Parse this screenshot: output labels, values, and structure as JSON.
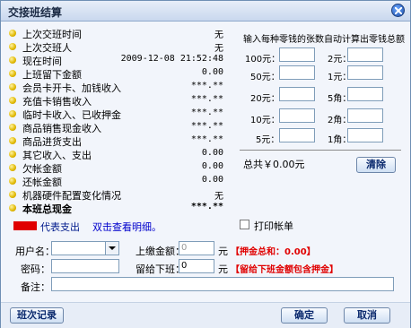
{
  "window": {
    "title": "交接班结算"
  },
  "summary": {
    "rows": [
      {
        "label": "上次交班时间",
        "value": "无"
      },
      {
        "label": "上次交班人",
        "value": "无"
      },
      {
        "label": "现在时间",
        "value": "2009-12-08 21:52:48"
      },
      {
        "label": "上班留下金额",
        "value": "0.00"
      },
      {
        "label": "会员卡开卡、加钱收入",
        "value": "***.**"
      },
      {
        "label": "充值卡销售收入",
        "value": "***.**"
      },
      {
        "label": "临时卡收入、已收押金",
        "value": "***.**"
      },
      {
        "label": "商品销售现金收入",
        "value": "***.**"
      },
      {
        "label": "商品进货支出",
        "value": "***.**"
      },
      {
        "label": "其它收入、支出",
        "value": "0.00"
      },
      {
        "label": "欠帐金额",
        "value": "0.00"
      },
      {
        "label": "还帐金额",
        "value": "0.00"
      },
      {
        "label": "机器硬件配置变化情况",
        "value": "无"
      },
      {
        "label": "本班总现金",
        "value": "***.**"
      }
    ]
  },
  "legend": {
    "text": "代表支出",
    "link": "双击查看明细。",
    "color": "#e00000"
  },
  "money": {
    "hint": "输入每种零钱的张数自动计算出零钱总额",
    "left": [
      "100元：",
      "50元：",
      "20元：",
      "10元：",
      "5元："
    ],
    "right": [
      "2元：",
      "1元：",
      "5角：",
      "2角：",
      "1角："
    ],
    "total": "总共￥0.00元",
    "clear": "清除"
  },
  "print": {
    "label": "打印帐单"
  },
  "form": {
    "user_label": "用户名：",
    "password_label": "密码：",
    "paid_label": "上缴金额：",
    "paid_value": "0",
    "unit1": "元",
    "note1": "【押金总和：0.00】",
    "left_label": "留给下班：",
    "left_value": "0",
    "unit2": "元",
    "note2": "【留给下班金额包含押金】",
    "remark_label": "备注："
  },
  "buttons": {
    "history": "班次记录",
    "ok": "确定",
    "cancel": "取消"
  }
}
